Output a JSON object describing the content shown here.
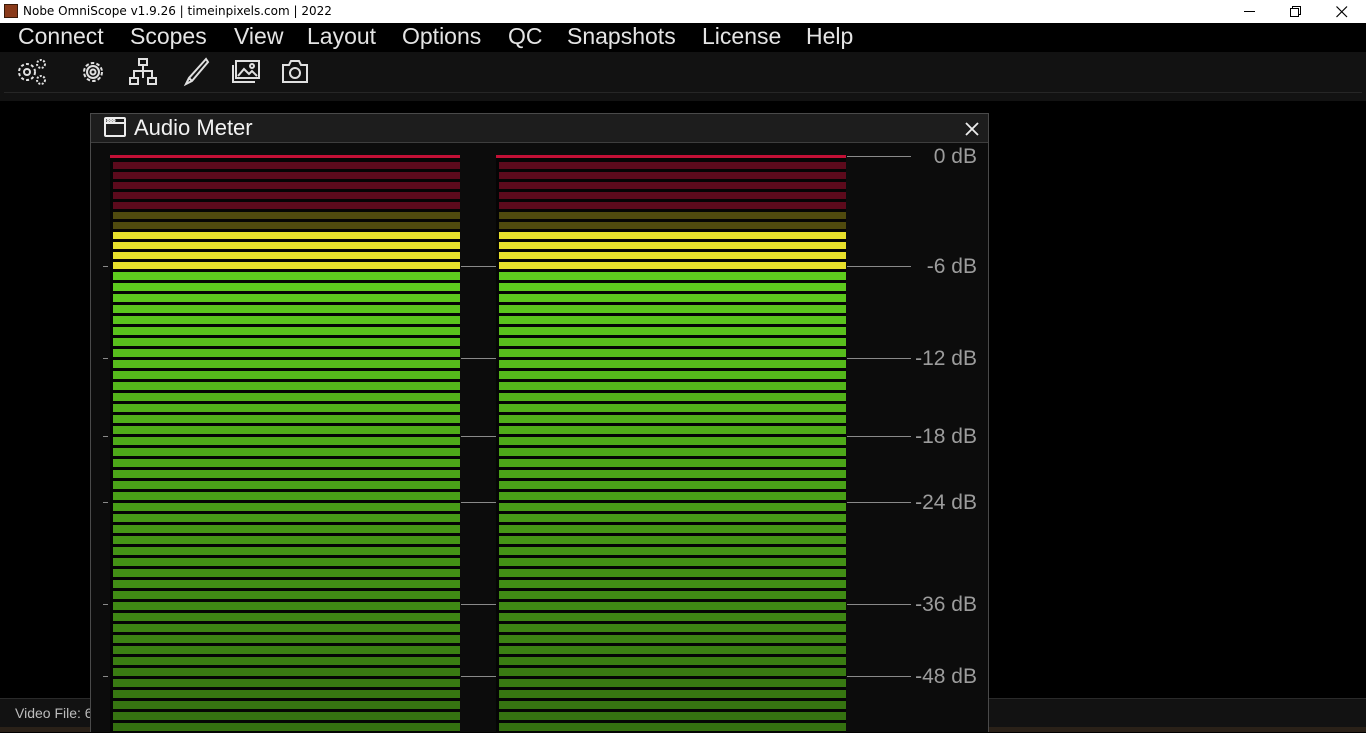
{
  "window": {
    "title": "Nobe OmniScope v1.9.26 | timeinpixels.com | 2022"
  },
  "menu": [
    "Connect",
    "Scopes",
    "View",
    "Layout",
    "Options",
    "QC",
    "Snapshots",
    "License",
    "Help"
  ],
  "toolbar": [
    {
      "name": "advanced-settings-icon"
    },
    {
      "name": "settings-icon"
    },
    {
      "name": "network-icon"
    },
    {
      "name": "pen-icon"
    },
    {
      "name": "image-gallery-icon"
    },
    {
      "name": "camera-icon"
    }
  ],
  "panel": {
    "title": "Audio Meter",
    "icon": "window-icon",
    "close_icon": "close-icon"
  },
  "meter": {
    "channels": 2,
    "scale": [
      "0 dB",
      "-6 dB",
      "-12 dB",
      "-18 dB",
      "-24 dB",
      "-36 dB",
      "-48 dB"
    ],
    "colors": {
      "red": "#5c0a1c",
      "olive": "#4f4a0e",
      "yellow": "#e6df2c",
      "green": "#5ecc1e",
      "peak": "#c21036"
    }
  },
  "status": {
    "text": "Video File: 6"
  }
}
